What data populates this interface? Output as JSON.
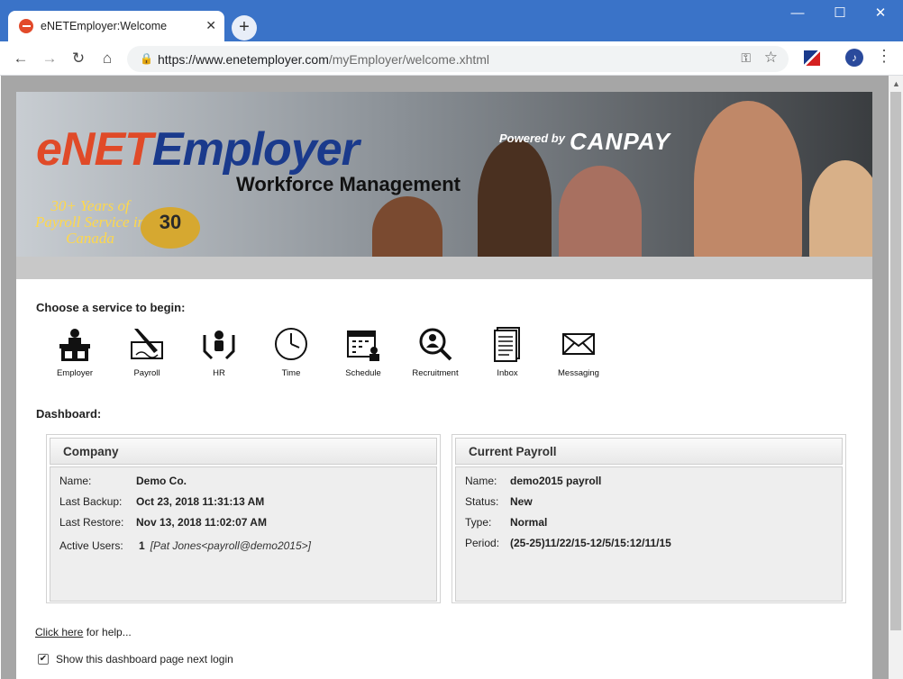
{
  "browser": {
    "tab_title": "eNETEmployer:Welcome",
    "tab_close": "✕",
    "new_tab": "+",
    "url_host": "https://www.enetemployer.com",
    "url_path": "/myEmployer/welcome.xhtml",
    "window_controls": {
      "minimize": "—",
      "maximize": "☐",
      "close": "✕"
    },
    "icons": [
      "back-icon",
      "forward-icon",
      "reload-icon",
      "home-icon",
      "lock-icon",
      "key-icon",
      "star-icon",
      "menu-icon"
    ]
  },
  "banner": {
    "logo_e": "e",
    "logo_net": "NET",
    "logo_employer": "Employer",
    "subtitle": "Workforce Management",
    "years_text": "30+ Years of Payroll Service in Canada",
    "seal_text": "30",
    "powered_by": "Powered by",
    "canpay": "CANPAY"
  },
  "services": {
    "heading": "Choose a service to begin:",
    "items": [
      {
        "label": "Employer",
        "icon": "employer-icon"
      },
      {
        "label": "Payroll",
        "icon": "payroll-icon"
      },
      {
        "label": "HR",
        "icon": "hr-icon"
      },
      {
        "label": "Time",
        "icon": "clock-icon"
      },
      {
        "label": "Schedule",
        "icon": "calendar-icon"
      },
      {
        "label": "Recruitment",
        "icon": "magnifier-icon"
      },
      {
        "label": "Inbox",
        "icon": "document-icon"
      },
      {
        "label": "Messaging",
        "icon": "envelope-icon"
      }
    ]
  },
  "dashboard": {
    "heading": "Dashboard:",
    "company": {
      "title": "Company",
      "name_label": "Name:",
      "name": "Demo Co.",
      "backup_label": "Last Backup:",
      "backup": "Oct 23, 2018 11:31:13 AM",
      "restore_label": "Last Restore:",
      "restore": "Nov 13, 2018 11:02:07 AM",
      "users_label": "Active Users:",
      "users_count": "1",
      "users_list": "[Pat Jones<payroll@demo2015>]"
    },
    "payroll": {
      "title": "Current Payroll",
      "name_label": "Name:",
      "name": "demo2015 payroll",
      "status_label": "Status:",
      "status": "New",
      "type_label": "Type:",
      "type": "Normal",
      "period_label": "Period:",
      "period": "(25-25)11/22/15-12/5/15:12/11/15"
    }
  },
  "footer": {
    "help_link": "Click here",
    "help_text": "for help...",
    "show_checkbox_label": "Show this dashboard page next login",
    "show_checkbox_checked": true
  }
}
